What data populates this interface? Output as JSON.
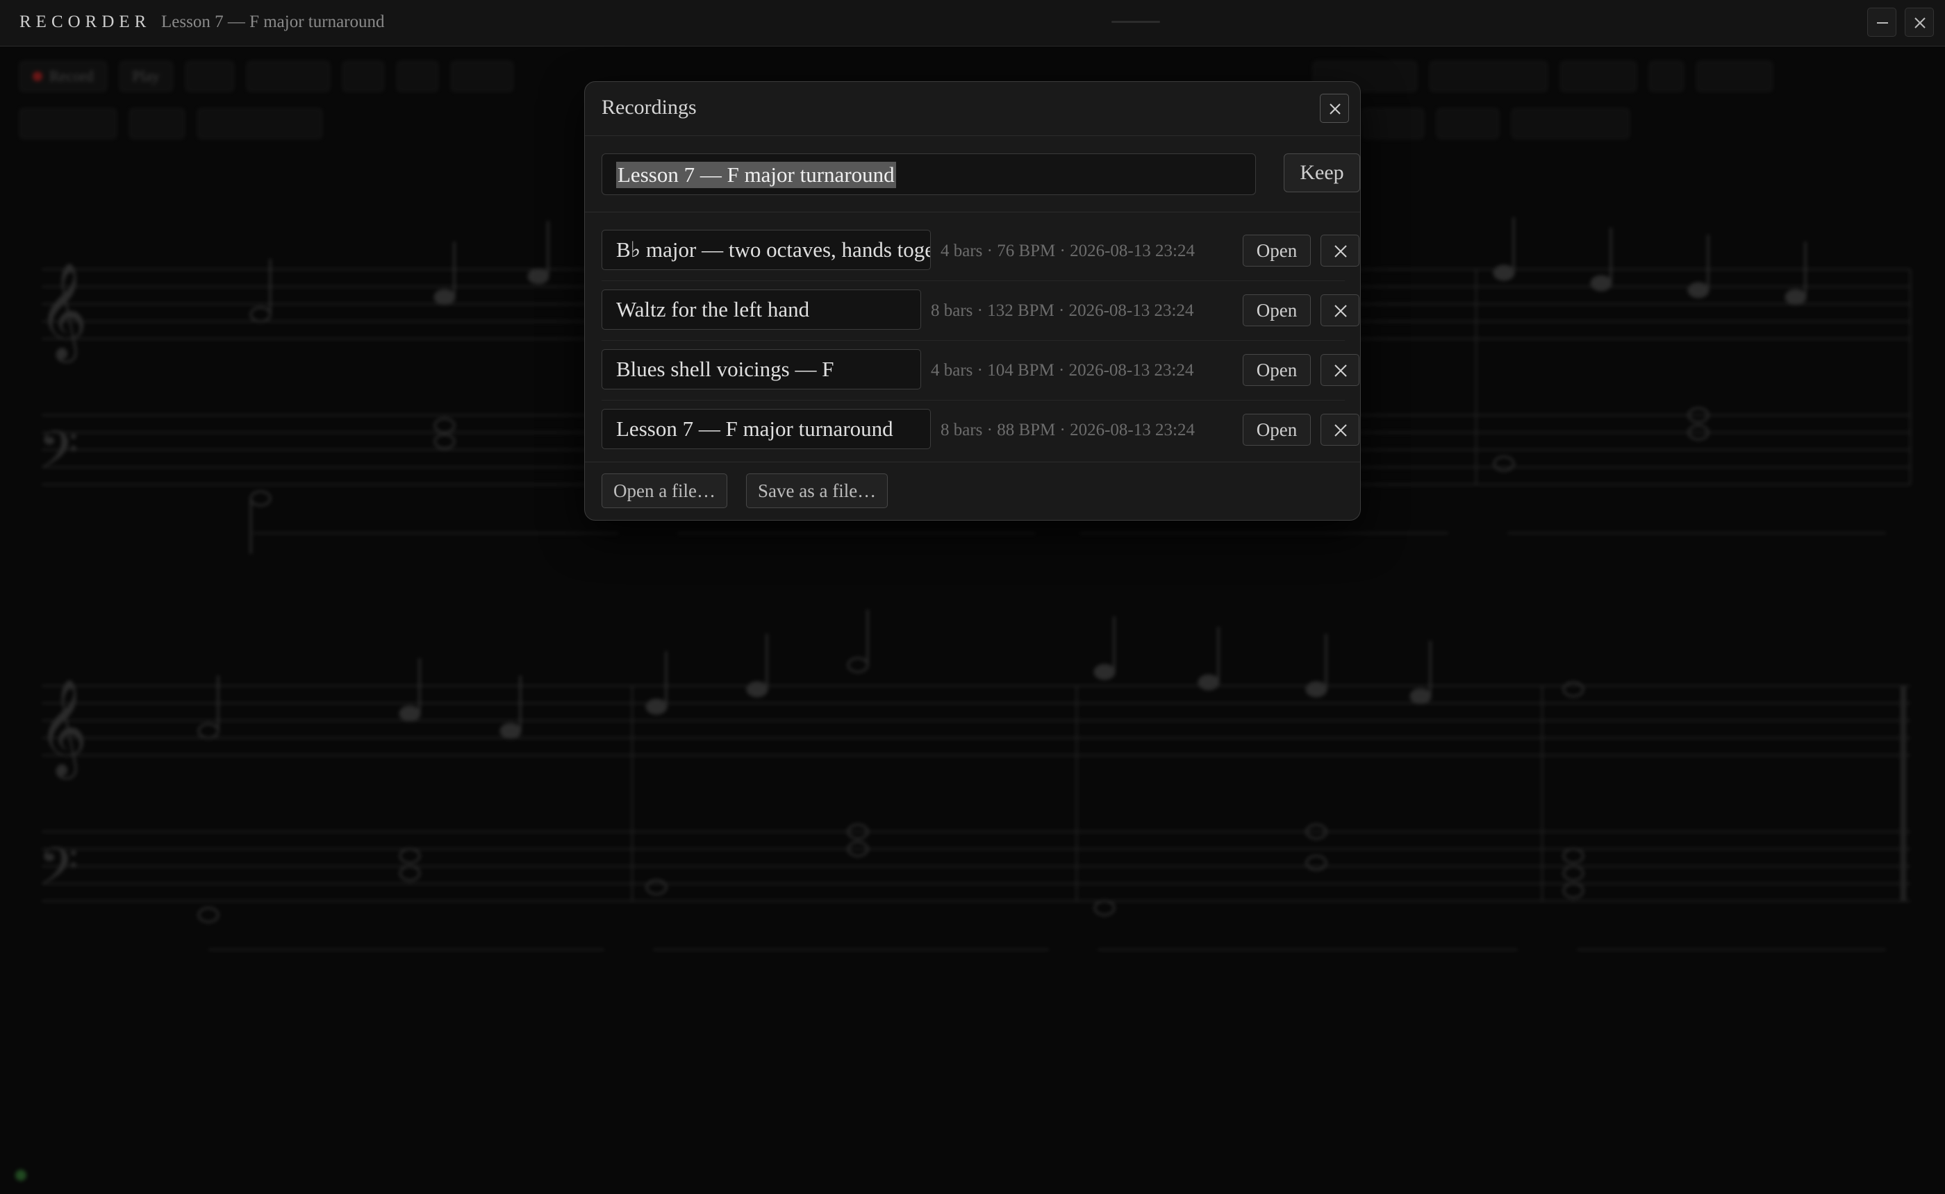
{
  "app": {
    "name": "RECORDER",
    "document_title": "Lesson 7 — F major turnaround"
  },
  "background": {
    "toolbar": [
      "Record",
      "Play"
    ],
    "status": {
      "left": "",
      "middle": ""
    }
  },
  "dialog": {
    "title": "Recordings",
    "name_input_value": "Lesson 7 — F major turnaround",
    "keep_label": "Keep",
    "recordings": [
      {
        "name": "B♭ major — two octaves, hands together",
        "meta": "4 bars · 76 BPM · 2026-08-13 23:24",
        "open_label": "Open"
      },
      {
        "name": "Waltz for the left hand",
        "meta": "8 bars · 132 BPM · 2026-08-13 23:24",
        "open_label": "Open"
      },
      {
        "name": "Blues shell voicings — F",
        "meta": "4 bars · 104 BPM · 2026-08-13 23:24",
        "open_label": "Open"
      },
      {
        "name": "Lesson 7 — F major turnaround",
        "meta": "8 bars · 88 BPM · 2026-08-13 23:24",
        "open_label": "Open"
      }
    ],
    "open_file_label": "Open a file…",
    "save_file_label": "Save as a file…"
  },
  "colors": {
    "background": "#080808",
    "dialog": "#1a1a1a",
    "selection": "#585858",
    "record": "#bb2222"
  },
  "icons": [
    "minimize-icon",
    "close-icon",
    "delete-icon"
  ]
}
